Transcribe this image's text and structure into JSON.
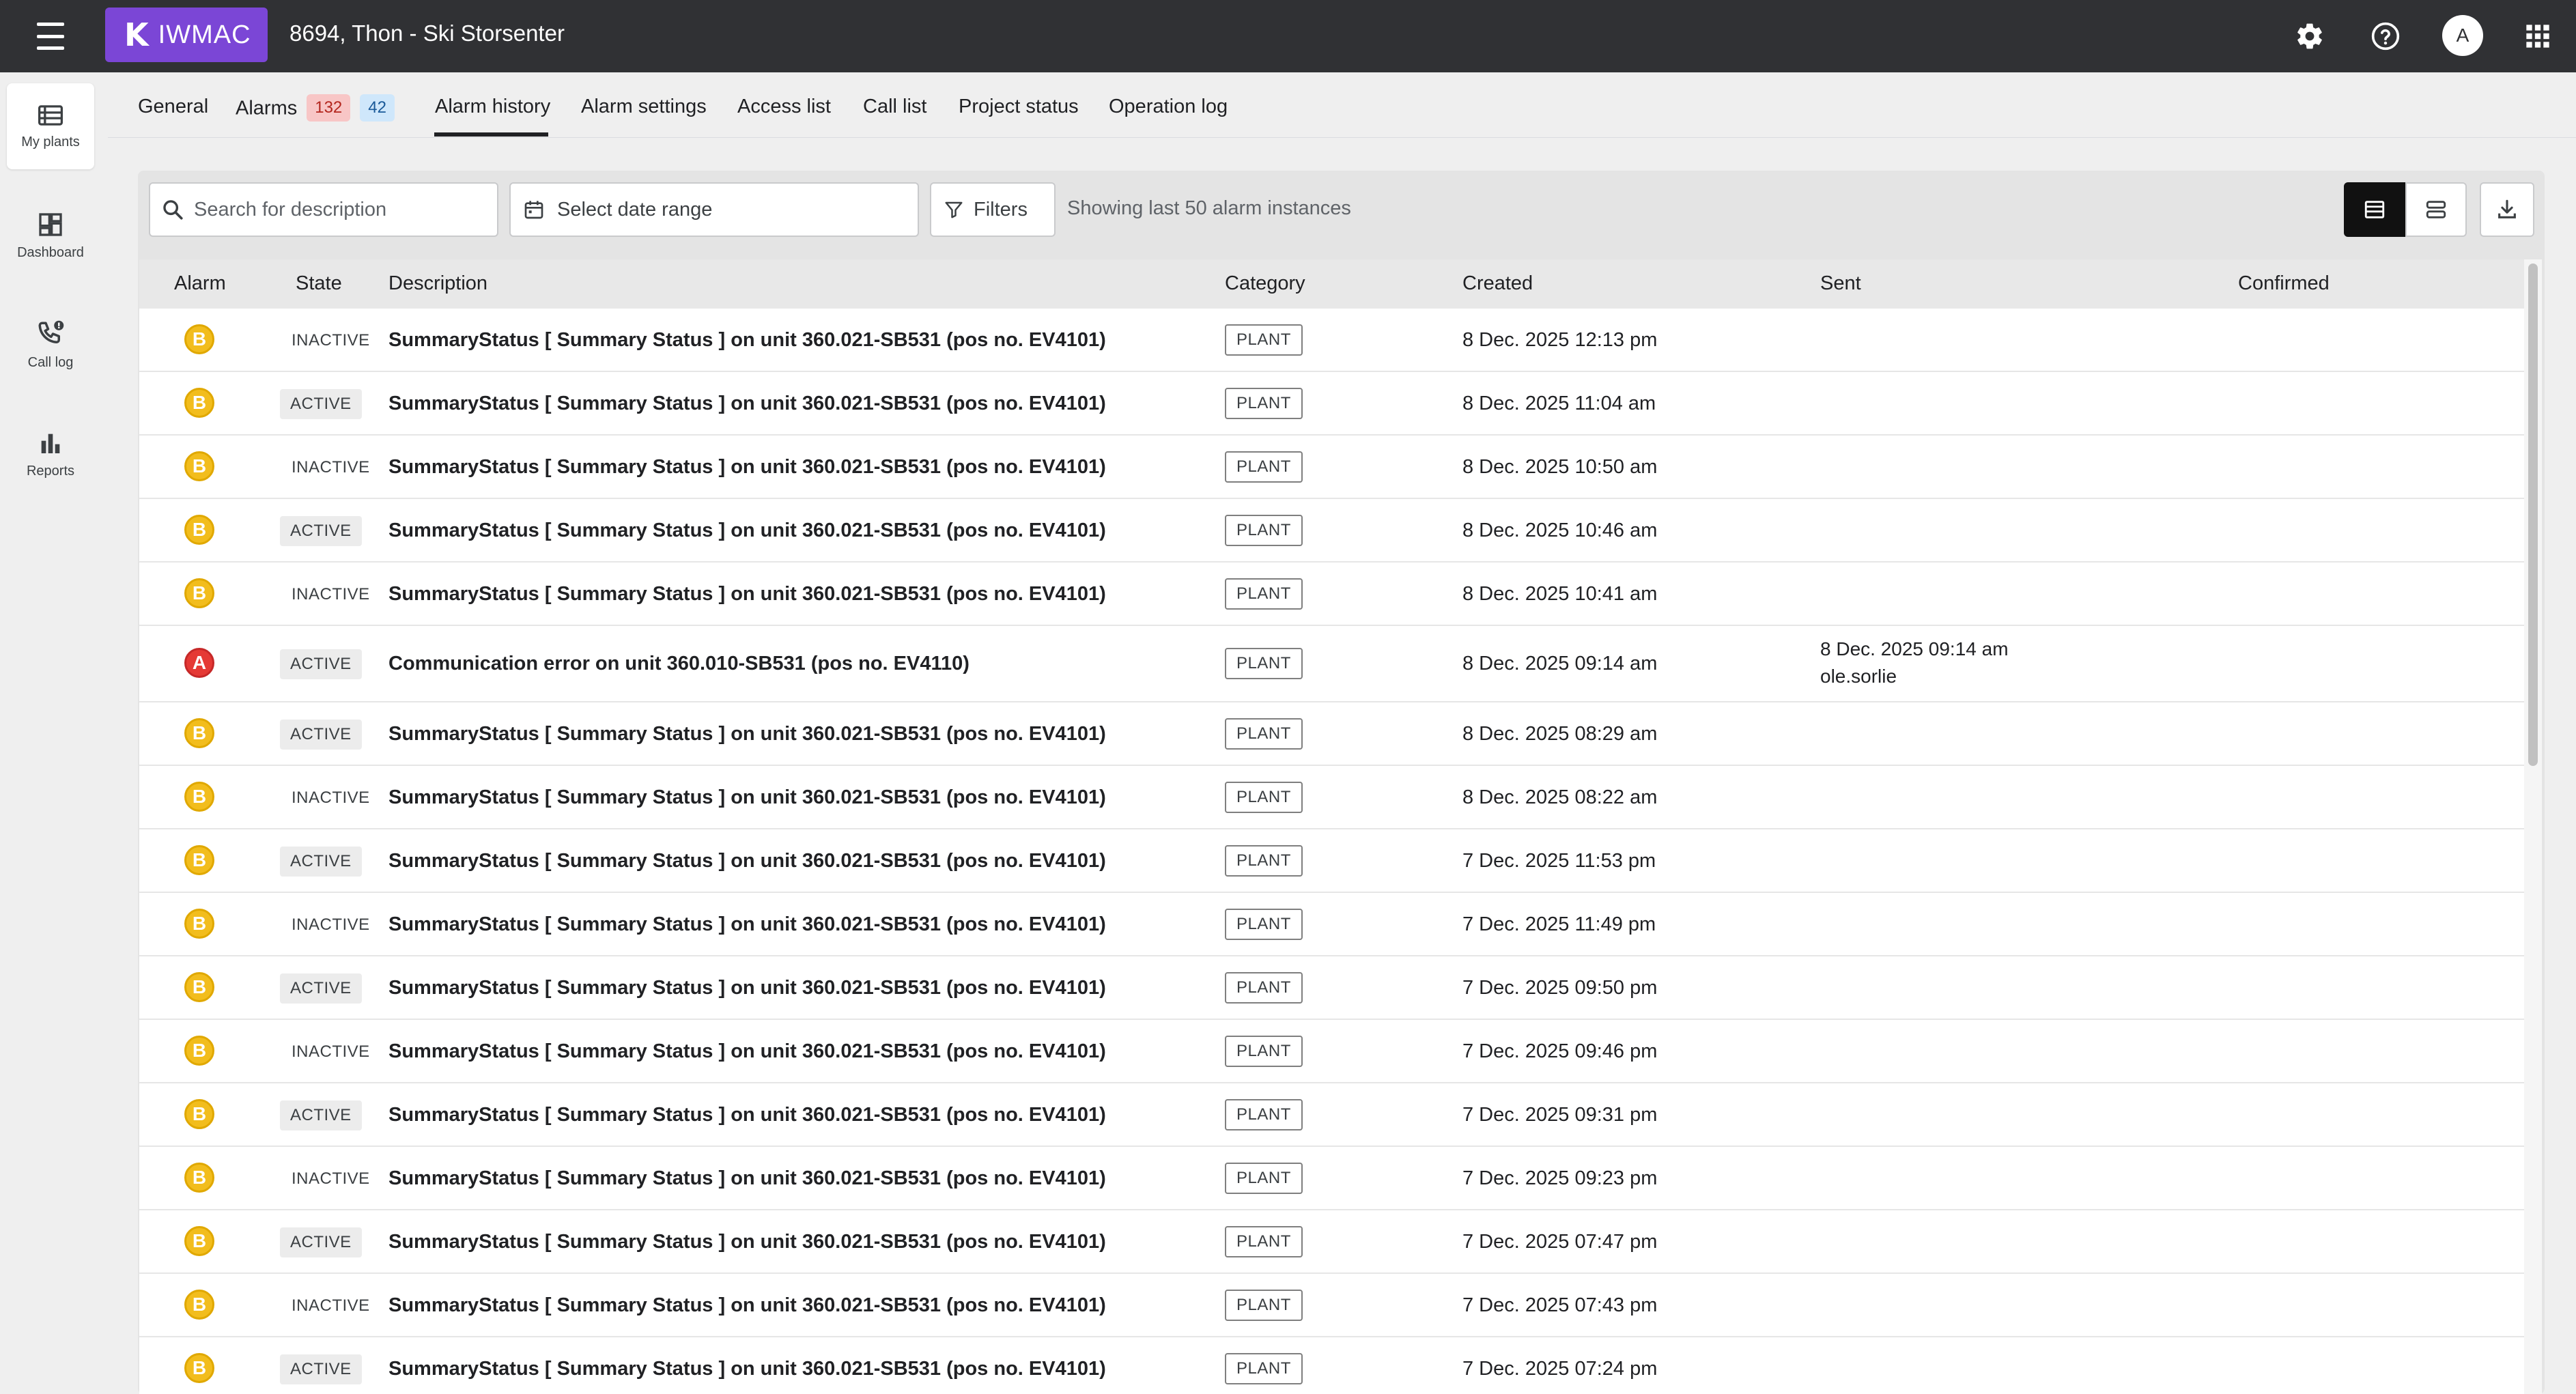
{
  "app": {
    "logo_text": "IWMAC",
    "site_title": "8694, Thon - Ski Storsenter",
    "user_initial": "A"
  },
  "sidebar": {
    "items": [
      {
        "label": "My plants",
        "icon": "list-icon",
        "active": true
      },
      {
        "label": "Dashboard",
        "icon": "dashboard-icon",
        "active": false
      },
      {
        "label": "Call log",
        "icon": "phone-alert-icon",
        "active": false
      },
      {
        "label": "Reports",
        "icon": "bar-chart-icon",
        "active": false
      }
    ]
  },
  "tabs": {
    "general": "General",
    "alarms": "Alarms",
    "alarms_red_count": "132",
    "alarms_blue_count": "42",
    "alarm_history": "Alarm history",
    "alarm_settings": "Alarm settings",
    "access_list": "Access list",
    "call_list": "Call list",
    "project_status": "Project status",
    "operation_log": "Operation log",
    "active_tab": "Alarm history"
  },
  "toolbar": {
    "search_placeholder": "Search for description",
    "date_range_label": "Select date range",
    "filters_label": "Filters",
    "showing_text": "Showing last 50 alarm instances"
  },
  "colors": {
    "accent": "#7b46d6",
    "topbar": "#303134",
    "alarm_b": "#f2bd1d",
    "alarm_a": "#e53935",
    "badge_red_bg": "#f8c6c6",
    "badge_blue_bg": "#cfe7fb"
  },
  "table": {
    "headers": {
      "alarm": "Alarm",
      "state": "State",
      "description": "Description",
      "category": "Category",
      "created": "Created",
      "sent": "Sent",
      "confirmed": "Confirmed"
    },
    "rows": [
      {
        "alarm": "B",
        "state": "INACTIVE",
        "description": "SummaryStatus [ Summary Status ] on unit 360.021-SB531 (pos no. EV4101)",
        "category": "PLANT",
        "created": "8 Dec. 2025 12:13 pm",
        "sent": "",
        "sent_by": "",
        "confirmed": ""
      },
      {
        "alarm": "B",
        "state": "ACTIVE",
        "description": "SummaryStatus [ Summary Status ] on unit 360.021-SB531 (pos no. EV4101)",
        "category": "PLANT",
        "created": "8 Dec. 2025 11:04 am",
        "sent": "",
        "sent_by": "",
        "confirmed": ""
      },
      {
        "alarm": "B",
        "state": "INACTIVE",
        "description": "SummaryStatus [ Summary Status ] on unit 360.021-SB531 (pos no. EV4101)",
        "category": "PLANT",
        "created": "8 Dec. 2025 10:50 am",
        "sent": "",
        "sent_by": "",
        "confirmed": ""
      },
      {
        "alarm": "B",
        "state": "ACTIVE",
        "description": "SummaryStatus [ Summary Status ] on unit 360.021-SB531 (pos no. EV4101)",
        "category": "PLANT",
        "created": "8 Dec. 2025 10:46 am",
        "sent": "",
        "sent_by": "",
        "confirmed": ""
      },
      {
        "alarm": "B",
        "state": "INACTIVE",
        "description": "SummaryStatus [ Summary Status ] on unit 360.021-SB531 (pos no. EV4101)",
        "category": "PLANT",
        "created": "8 Dec. 2025 10:41 am",
        "sent": "",
        "sent_by": "",
        "confirmed": ""
      },
      {
        "alarm": "A",
        "state": "ACTIVE",
        "description": "Communication error on unit 360.010-SB531 (pos no. EV4110)",
        "category": "PLANT",
        "created": "8 Dec. 2025 09:14 am",
        "sent": "8 Dec. 2025 09:14 am",
        "sent_by": "ole.sorlie",
        "confirmed": ""
      },
      {
        "alarm": "B",
        "state": "ACTIVE",
        "description": "SummaryStatus [ Summary Status ] on unit 360.021-SB531 (pos no. EV4101)",
        "category": "PLANT",
        "created": "8 Dec. 2025 08:29 am",
        "sent": "",
        "sent_by": "",
        "confirmed": ""
      },
      {
        "alarm": "B",
        "state": "INACTIVE",
        "description": "SummaryStatus [ Summary Status ] on unit 360.021-SB531 (pos no. EV4101)",
        "category": "PLANT",
        "created": "8 Dec. 2025 08:22 am",
        "sent": "",
        "sent_by": "",
        "confirmed": ""
      },
      {
        "alarm": "B",
        "state": "ACTIVE",
        "description": "SummaryStatus [ Summary Status ] on unit 360.021-SB531 (pos no. EV4101)",
        "category": "PLANT",
        "created": "7 Dec. 2025 11:53 pm",
        "sent": "",
        "sent_by": "",
        "confirmed": ""
      },
      {
        "alarm": "B",
        "state": "INACTIVE",
        "description": "SummaryStatus [ Summary Status ] on unit 360.021-SB531 (pos no. EV4101)",
        "category": "PLANT",
        "created": "7 Dec. 2025 11:49 pm",
        "sent": "",
        "sent_by": "",
        "confirmed": ""
      },
      {
        "alarm": "B",
        "state": "ACTIVE",
        "description": "SummaryStatus [ Summary Status ] on unit 360.021-SB531 (pos no. EV4101)",
        "category": "PLANT",
        "created": "7 Dec. 2025 09:50 pm",
        "sent": "",
        "sent_by": "",
        "confirmed": ""
      },
      {
        "alarm": "B",
        "state": "INACTIVE",
        "description": "SummaryStatus [ Summary Status ] on unit 360.021-SB531 (pos no. EV4101)",
        "category": "PLANT",
        "created": "7 Dec. 2025 09:46 pm",
        "sent": "",
        "sent_by": "",
        "confirmed": ""
      },
      {
        "alarm": "B",
        "state": "ACTIVE",
        "description": "SummaryStatus [ Summary Status ] on unit 360.021-SB531 (pos no. EV4101)",
        "category": "PLANT",
        "created": "7 Dec. 2025 09:31 pm",
        "sent": "",
        "sent_by": "",
        "confirmed": ""
      },
      {
        "alarm": "B",
        "state": "INACTIVE",
        "description": "SummaryStatus [ Summary Status ] on unit 360.021-SB531 (pos no. EV4101)",
        "category": "PLANT",
        "created": "7 Dec. 2025 09:23 pm",
        "sent": "",
        "sent_by": "",
        "confirmed": ""
      },
      {
        "alarm": "B",
        "state": "ACTIVE",
        "description": "SummaryStatus [ Summary Status ] on unit 360.021-SB531 (pos no. EV4101)",
        "category": "PLANT",
        "created": "7 Dec. 2025 07:47 pm",
        "sent": "",
        "sent_by": "",
        "confirmed": ""
      },
      {
        "alarm": "B",
        "state": "INACTIVE",
        "description": "SummaryStatus [ Summary Status ] on unit 360.021-SB531 (pos no. EV4101)",
        "category": "PLANT",
        "created": "7 Dec. 2025 07:43 pm",
        "sent": "",
        "sent_by": "",
        "confirmed": ""
      },
      {
        "alarm": "B",
        "state": "ACTIVE",
        "description": "SummaryStatus [ Summary Status ] on unit 360.021-SB531 (pos no. EV4101)",
        "category": "PLANT",
        "created": "7 Dec. 2025 07:24 pm",
        "sent": "",
        "sent_by": "",
        "confirmed": ""
      }
    ]
  }
}
